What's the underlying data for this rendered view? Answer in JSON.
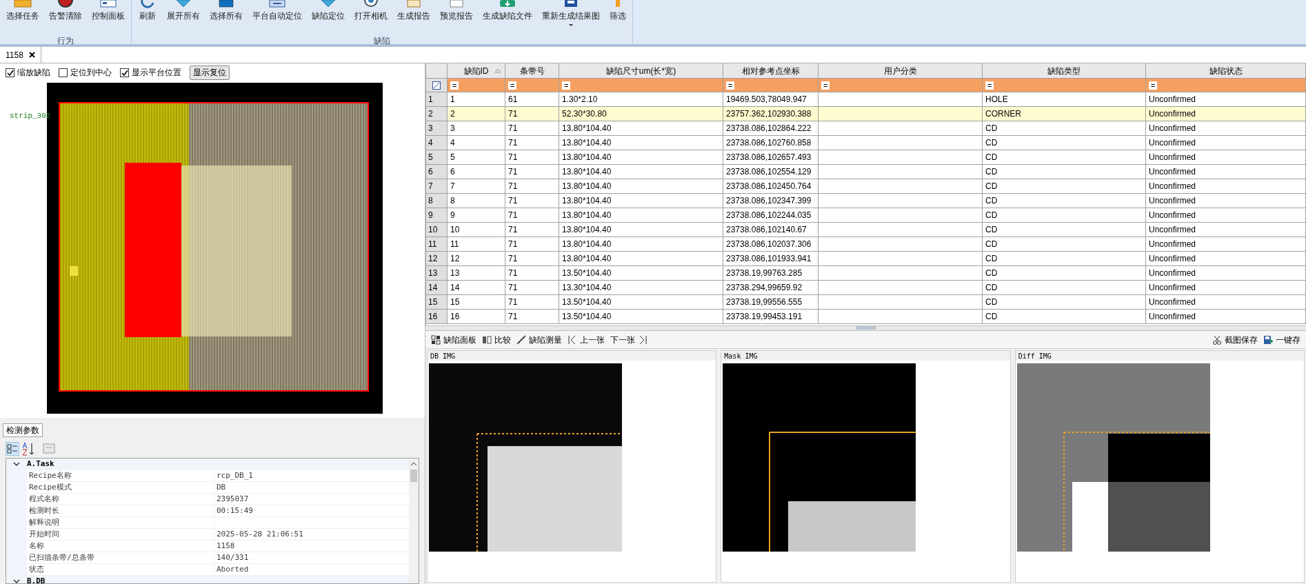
{
  "ribbon": {
    "groups": [
      {
        "label": "行为",
        "buttons": [
          {
            "label": "选择任务",
            "kind": "folder"
          },
          {
            "label": "告警清除",
            "kind": "alarm"
          },
          {
            "label": "控制面板",
            "kind": "panel"
          }
        ]
      },
      {
        "label": "缺陷",
        "buttons": [
          {
            "label": "刷新",
            "kind": "refresh"
          },
          {
            "label": "展开所有",
            "kind": "funnel"
          },
          {
            "label": "选择所有",
            "kind": "square"
          },
          {
            "label": "平台自动定位",
            "kind": "monitor"
          },
          {
            "label": "缺陷定位",
            "kind": "funnel"
          },
          {
            "label": "打开相机",
            "kind": "camera"
          },
          {
            "label": "生成报告",
            "kind": "report"
          },
          {
            "label": "预览报告",
            "kind": "page"
          },
          {
            "label": "生成缺陷文件",
            "kind": "disk"
          },
          {
            "label": "重新生成结果图",
            "kind": "save",
            "dropdown": true
          },
          {
            "label": "筛选",
            "kind": "bar"
          }
        ]
      }
    ]
  },
  "tabs": [
    {
      "label": "1158",
      "selected": true
    }
  ],
  "viewer": {
    "options": [
      {
        "label": "缩放缺陷",
        "checked": true
      },
      {
        "label": "定位到中心",
        "checked": false
      },
      {
        "label": "显示平台位置",
        "checked": true
      }
    ],
    "reset_button": "显示复位",
    "strip_label": "strip_302"
  },
  "properties": {
    "tab": "检测参数",
    "categories": [
      {
        "title": "A.Task",
        "expanded": true,
        "rows": [
          {
            "name": "Recipe名称",
            "value": "rcp_DB_1"
          },
          {
            "name": "Recipe模式",
            "value": "DB"
          },
          {
            "name": "程式名称",
            "value": "2395037"
          },
          {
            "name": "检测时长",
            "value": "00:15:49"
          },
          {
            "name": "解释说明",
            "value": ""
          },
          {
            "name": "开始时间",
            "value": "2025-05-28 21:06:51"
          },
          {
            "name": "名称",
            "value": "1158"
          },
          {
            "name": "已扫描条带/总条带",
            "value": "140/331"
          },
          {
            "name": "状态",
            "value": "Aborted"
          }
        ]
      },
      {
        "title": "B.DB",
        "expanded": true
      }
    ]
  },
  "table": {
    "columns": [
      "缺陷ID",
      "条带号",
      "缺陷尺寸um(长*宽)",
      "相对参考点坐标",
      "用户分类",
      "缺陷类型",
      "缺陷状态"
    ],
    "filter_symbol": "=",
    "rows": [
      {
        "n": "1",
        "cells": [
          "1",
          "61",
          "1.30*2.10",
          "19469.503,78049.947",
          "",
          "HOLE",
          "Unconfirmed"
        ],
        "selected": false
      },
      {
        "n": "2",
        "cells": [
          "2",
          "71",
          "52.30*30.80",
          "23757.362,102930.388",
          "",
          "CORNER",
          "Unconfirmed"
        ],
        "selected": true
      },
      {
        "n": "3",
        "cells": [
          "3",
          "71",
          "13.80*104.40",
          "23738.086,102864.222",
          "",
          "CD",
          "Unconfirmed"
        ],
        "selected": false
      },
      {
        "n": "4",
        "cells": [
          "4",
          "71",
          "13.80*104.40",
          "23738.086,102760.858",
          "",
          "CD",
          "Unconfirmed"
        ],
        "selected": false
      },
      {
        "n": "5",
        "cells": [
          "5",
          "71",
          "13.80*104.40",
          "23738.086,102657.493",
          "",
          "CD",
          "Unconfirmed"
        ],
        "selected": false
      },
      {
        "n": "6",
        "cells": [
          "6",
          "71",
          "13.80*104.40",
          "23738.086,102554.129",
          "",
          "CD",
          "Unconfirmed"
        ],
        "selected": false
      },
      {
        "n": "7",
        "cells": [
          "7",
          "71",
          "13.80*104.40",
          "23738.086,102450.764",
          "",
          "CD",
          "Unconfirmed"
        ],
        "selected": false
      },
      {
        "n": "8",
        "cells": [
          "8",
          "71",
          "13.80*104.40",
          "23738.086,102347.399",
          "",
          "CD",
          "Unconfirmed"
        ],
        "selected": false
      },
      {
        "n": "9",
        "cells": [
          "9",
          "71",
          "13.80*104.40",
          "23738.086,102244.035",
          "",
          "CD",
          "Unconfirmed"
        ],
        "selected": false
      },
      {
        "n": "10",
        "cells": [
          "10",
          "71",
          "13.80*104.40",
          "23738.086,102140.67",
          "",
          "CD",
          "Unconfirmed"
        ],
        "selected": false
      },
      {
        "n": "11",
        "cells": [
          "11",
          "71",
          "13.80*104.40",
          "23738.086,102037.306",
          "",
          "CD",
          "Unconfirmed"
        ],
        "selected": false
      },
      {
        "n": "12",
        "cells": [
          "12",
          "71",
          "13.80*104.40",
          "23738.086,101933.941",
          "",
          "CD",
          "Unconfirmed"
        ],
        "selected": false
      },
      {
        "n": "13",
        "cells": [
          "13",
          "71",
          "13.50*104.40",
          "23738.19,99763.285",
          "",
          "CD",
          "Unconfirmed"
        ],
        "selected": false
      },
      {
        "n": "14",
        "cells": [
          "14",
          "71",
          "13.30*104.40",
          "23738.294,99659.92",
          "",
          "CD",
          "Unconfirmed"
        ],
        "selected": false
      },
      {
        "n": "15",
        "cells": [
          "15",
          "71",
          "13.50*104.40",
          "23738.19,99556.555",
          "",
          "CD",
          "Unconfirmed"
        ],
        "selected": false
      },
      {
        "n": "16",
        "cells": [
          "16",
          "71",
          "13.50*104.40",
          "23738.19,99453.191",
          "",
          "CD",
          "Unconfirmed"
        ],
        "selected": false
      }
    ]
  },
  "image_toolbar": {
    "left": [
      {
        "label": "缺陷面板",
        "kind": "panel"
      },
      {
        "label": "比较",
        "kind": "compare"
      },
      {
        "label": "缺陷测量",
        "kind": "measure"
      },
      {
        "label": "上一张",
        "kind": "prev"
      },
      {
        "label": "下一张",
        "kind": "next"
      }
    ],
    "right": [
      {
        "label": "截图保存",
        "kind": "scissors"
      },
      {
        "label": "一键存",
        "kind": "disk"
      }
    ]
  },
  "image_panels": [
    {
      "title": "DB IMG",
      "kind": "db"
    },
    {
      "title": "Mask IMG",
      "kind": "mask"
    },
    {
      "title": "Diff IMG",
      "kind": "diff"
    }
  ]
}
